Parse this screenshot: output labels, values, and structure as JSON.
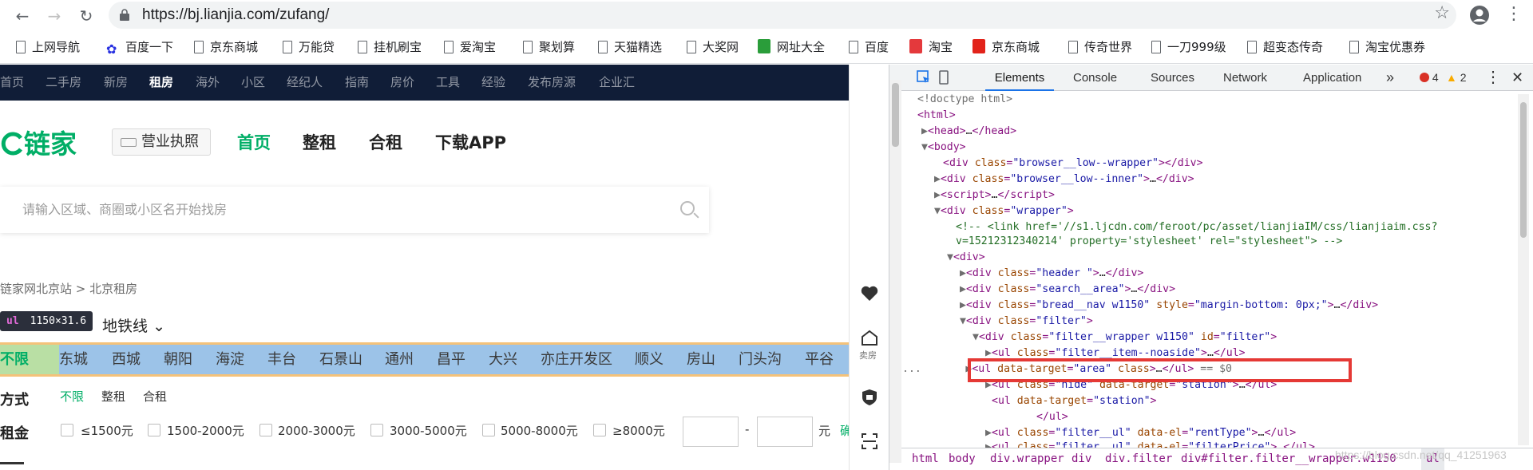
{
  "browser": {
    "url": "https://bj.lianjia.com/zufang/",
    "bookmarks": [
      "上网导航",
      "百度一下",
      "京东商城",
      "万能贷",
      "挂机刷宝",
      "爱淘宝",
      "聚划算",
      "天猫精选",
      "大奖网",
      "网址大全",
      "百度",
      "淘宝",
      "京东商城",
      "传奇世界",
      "一刀999级",
      "超变态传奇",
      "淘宝优惠券"
    ]
  },
  "page": {
    "topnav": [
      "首页",
      "二手房",
      "新房",
      "租房",
      "海外",
      "小区",
      "经纪人",
      "指南",
      "房价",
      "工具",
      "经验",
      "发布房源",
      "企业汇"
    ],
    "topnav_active": "租房",
    "logo": "链家",
    "license": "营业执照",
    "mainnav": [
      "首页",
      "整租",
      "合租",
      "下载APP"
    ],
    "search_placeholder": "请输入区域、商圈或小区名开始找房",
    "breadcrumb": "链家网北京站 >  北京租房",
    "tooltip_tag": "ul",
    "tooltip_size": "1150×31.6",
    "subway_tab": "地铁线",
    "areas_all": "不限",
    "areas": [
      "东城",
      "西城",
      "朝阳",
      "海淀",
      "丰台",
      "石景山",
      "通州",
      "昌平",
      "大兴",
      "亦庄开发区",
      "顺义",
      "房山",
      "门头沟",
      "平谷"
    ],
    "way_label": "方式",
    "ways": [
      "不限",
      "整租",
      "合租"
    ],
    "rent_label": "租金",
    "prices": [
      "≤1500元",
      "1500-2000元",
      "2000-3000元",
      "3000-5000元",
      "5000-8000元",
      "≥8000元"
    ],
    "price_dash": "-",
    "price_unit": "元",
    "price_confirm": "确",
    "float_label": "卖房"
  },
  "devtools": {
    "tabs": [
      "Elements",
      "Console",
      "Sources",
      "Network",
      "Application"
    ],
    "more": "»",
    "errors": "4",
    "warnings": "2",
    "crumbs": [
      "html",
      "body",
      "div.wrapper",
      "div",
      "div.filter",
      "div#filter.filter__wrapper.w1150",
      "ul"
    ],
    "watermark": "https://blog.csdn.net/qq_41251963"
  },
  "colors": {
    "accent": "#00ae66",
    "nav_bg": "#101d37",
    "highlight_row": "#9cc3e8",
    "highlight_margin": "#f4c27a"
  }
}
